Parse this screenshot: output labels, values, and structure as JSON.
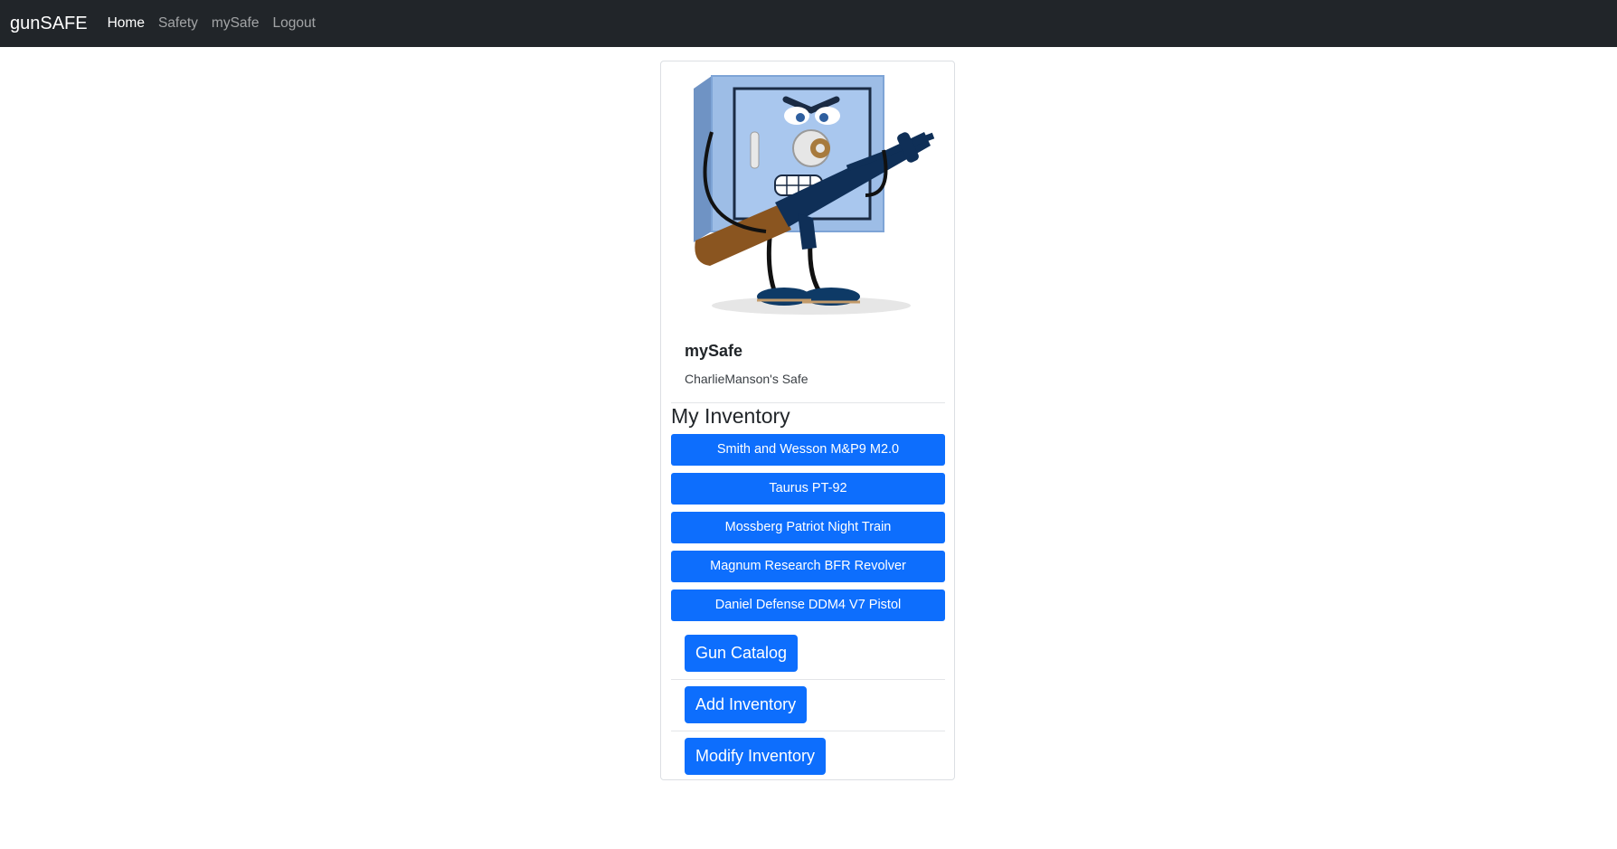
{
  "navbar": {
    "brand": "gunSAFE",
    "links": [
      {
        "label": "Home",
        "active": true
      },
      {
        "label": "Safety",
        "active": false
      },
      {
        "label": "mySafe",
        "active": false
      },
      {
        "label": "Logout",
        "active": false
      }
    ]
  },
  "card": {
    "image_icon": "safe-mascot-with-rifle",
    "title": "mySafe",
    "subtitle": "CharlieManson's Safe"
  },
  "inventory": {
    "heading": "My Inventory",
    "items": [
      "Smith and Wesson M&P9 M2.0",
      "Taurus PT-92",
      "Mossberg Patriot Night Train",
      "Magnum Research BFR Revolver",
      "Daniel Defense DDM4 V7 Pistol"
    ]
  },
  "actions": {
    "gun_catalog": "Gun Catalog",
    "add_inventory": "Add Inventory",
    "modify_inventory": "Modify Inventory"
  },
  "colors": {
    "navbar_bg": "#212529",
    "primary": "#0d6efd"
  }
}
